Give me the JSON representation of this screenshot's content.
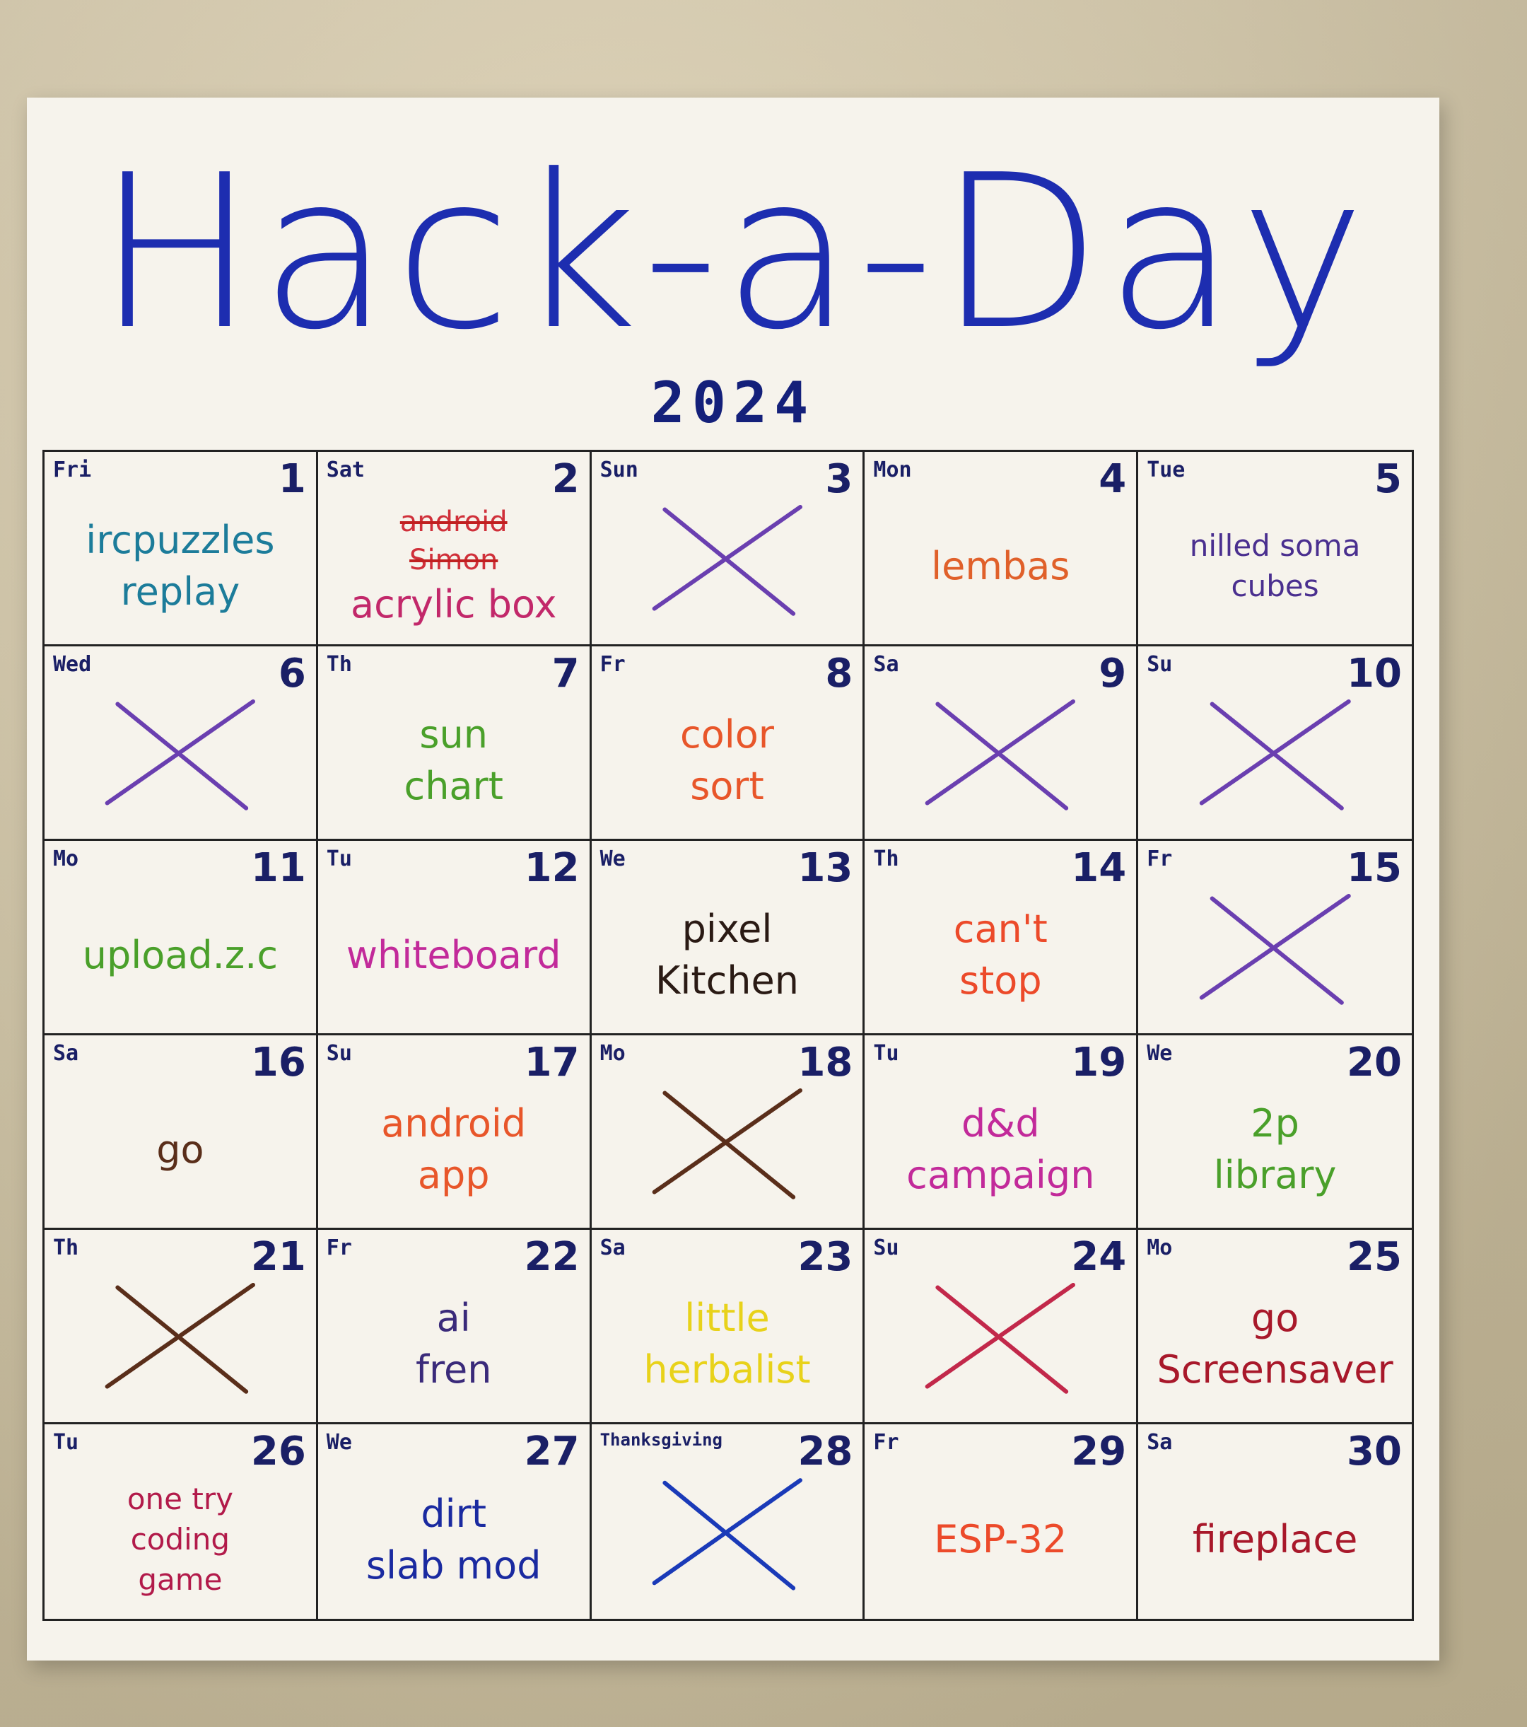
{
  "poster": {
    "title": "Hack-a-Day",
    "year": "2024"
  },
  "days": [
    {
      "dow": "Fri",
      "num": "1",
      "lines": [
        "ircpuzzles",
        "replay"
      ],
      "color": "#1c7c9a",
      "size": "normal"
    },
    {
      "dow": "Sat",
      "num": "2",
      "struck": [
        "android",
        "Simon"
      ],
      "lines": [
        "acrylic box"
      ],
      "color": "#c2286a",
      "struck_color": "#d0303a",
      "size": "normal"
    },
    {
      "dow": "Sun",
      "num": "3",
      "x": true,
      "xcolor": "#6a3fb0"
    },
    {
      "dow": "Mon",
      "num": "4",
      "lines": [
        "lembas"
      ],
      "color": "#e0602a",
      "size": "normal"
    },
    {
      "dow": "Tue",
      "num": "5",
      "lines": [
        "nilled soma",
        "cubes"
      ],
      "color": "#4a2f8f",
      "size": "small"
    },
    {
      "dow": "Wed",
      "num": "6",
      "x": true,
      "xcolor": "#6a3fb0"
    },
    {
      "dow": "Th",
      "num": "7",
      "lines": [
        "sun",
        "chart"
      ],
      "color": "#4aa02a",
      "size": "normal"
    },
    {
      "dow": "Fr",
      "num": "8",
      "lines": [
        "color",
        "sort"
      ],
      "color": "#e8562a",
      "size": "normal"
    },
    {
      "dow": "Sa",
      "num": "9",
      "x": true,
      "xcolor": "#6a3fb0"
    },
    {
      "dow": "Su",
      "num": "10",
      "x": true,
      "xcolor": "#6a3fb0"
    },
    {
      "dow": "Mo",
      "num": "11",
      "lines": [
        "upload.z.c"
      ],
      "color": "#4aa02a",
      "size": "normal"
    },
    {
      "dow": "Tu",
      "num": "12",
      "lines": [
        "whiteboard"
      ],
      "color": "#c22a9a",
      "size": "normal"
    },
    {
      "dow": "We",
      "num": "13",
      "lines": [
        "pixel",
        "Kitchen"
      ],
      "color": "#2a1a14",
      "size": "normal"
    },
    {
      "dow": "Th",
      "num": "14",
      "lines": [
        "can't",
        "stop"
      ],
      "color": "#ec4a2a",
      "size": "normal"
    },
    {
      "dow": "Fr",
      "num": "15",
      "x": true,
      "xcolor": "#6a3fb0"
    },
    {
      "dow": "Sa",
      "num": "16",
      "lines": [
        "go"
      ],
      "color": "#5a2e1a",
      "size": "normal"
    },
    {
      "dow": "Su",
      "num": "17",
      "lines": [
        "android",
        "app"
      ],
      "color": "#e8562a",
      "size": "normal"
    },
    {
      "dow": "Mo",
      "num": "18",
      "x": true,
      "xcolor": "#5a2e1a"
    },
    {
      "dow": "Tu",
      "num": "19",
      "lines": [
        "d&d",
        "campaign"
      ],
      "color": "#c22a9a",
      "size": "normal"
    },
    {
      "dow": "We",
      "num": "20",
      "lines": [
        "2p",
        "library"
      ],
      "color": "#4aa02a",
      "size": "normal"
    },
    {
      "dow": "Th",
      "num": "21",
      "x": true,
      "xcolor": "#5a2e1a"
    },
    {
      "dow": "Fr",
      "num": "22",
      "lines": [
        "ai",
        "fren"
      ],
      "color": "#3a2a7a",
      "size": "normal"
    },
    {
      "dow": "Sa",
      "num": "23",
      "lines": [
        "little",
        "herbalist"
      ],
      "color": "#e8d21a",
      "size": "normal"
    },
    {
      "dow": "Su",
      "num": "24",
      "x": true,
      "xcolor": "#c2284a"
    },
    {
      "dow": "Mo",
      "num": "25",
      "lines": [
        "go",
        "Screensaver"
      ],
      "color": "#a8182a",
      "size": "normal"
    },
    {
      "dow": "Tu",
      "num": "26",
      "lines": [
        "one try",
        "coding",
        "game"
      ],
      "color": "#b21a4a",
      "size": "small"
    },
    {
      "dow": "We",
      "num": "27",
      "lines": [
        "dirt",
        "slab mod"
      ],
      "color": "#1a2aa0",
      "size": "normal"
    },
    {
      "dow": "Thanksgiving",
      "num": "28",
      "x": true,
      "xcolor": "#1a3ab8"
    },
    {
      "dow": "Fr",
      "num": "29",
      "lines": [
        "ESP-32"
      ],
      "color": "#ec4a2a",
      "size": "normal"
    },
    {
      "dow": "Sa",
      "num": "30",
      "lines": [
        "fireplace"
      ],
      "color": "#a8182a",
      "size": "normal"
    }
  ]
}
